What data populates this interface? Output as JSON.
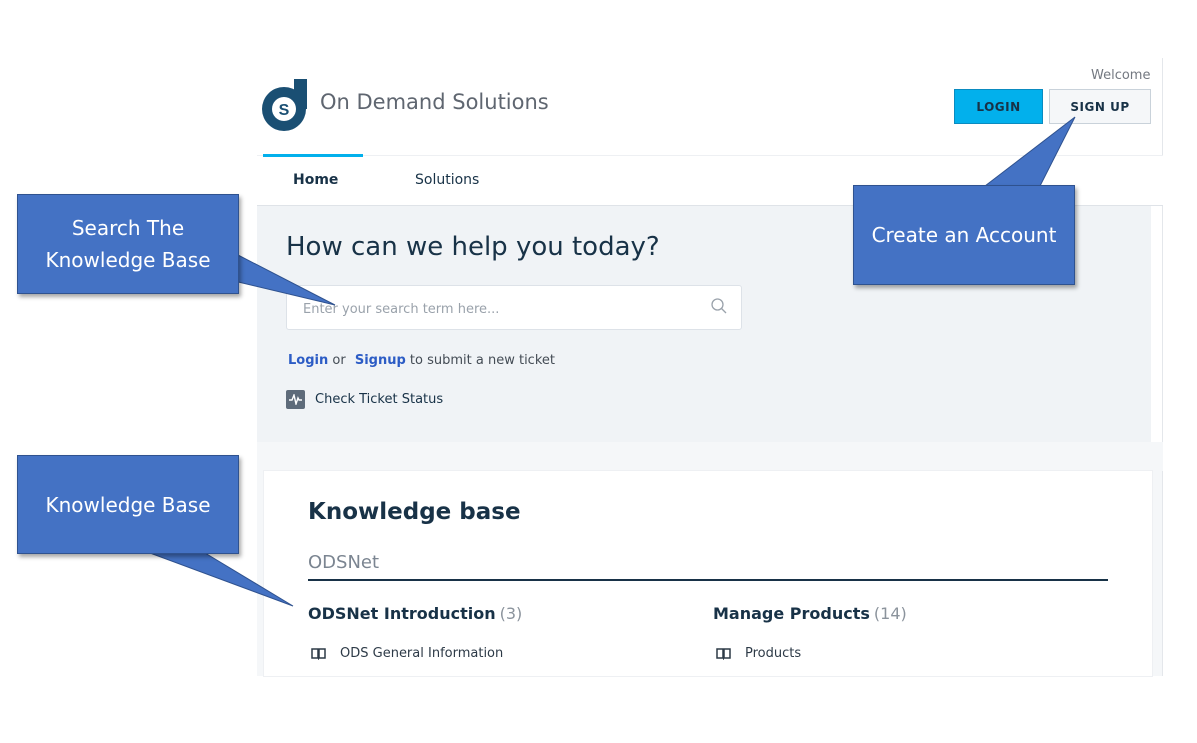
{
  "header": {
    "brand_name": "On Demand Solutions",
    "logo_letter": "S",
    "welcome_text": "Welcome",
    "login_label": "LOGIN",
    "signup_label": "SIGN UP"
  },
  "nav": {
    "tabs": [
      {
        "label": "Home",
        "active": true
      },
      {
        "label": "Solutions",
        "active": false
      }
    ]
  },
  "help": {
    "title": "How can we help you today?",
    "search_placeholder": "Enter your search term here...",
    "login_link": "Login",
    "or_text": "or",
    "signup_link": "Signup",
    "submit_text": "to submit a new ticket",
    "check_status": "Check Ticket Status"
  },
  "knowledge_base": {
    "title": "Knowledge base",
    "folder": "ODSNet",
    "categories": [
      {
        "name": "ODSNet Introduction",
        "count": "(3)",
        "first_article": "ODS General Information"
      },
      {
        "name": "Manage Products",
        "count": "(14)",
        "first_article": "Products"
      }
    ]
  },
  "callouts": {
    "search_line1": "Search The",
    "search_line2": "Knowledge Base",
    "account": "Create an Account",
    "kb": "Knowledge Base"
  },
  "colors": {
    "accent": "#02b0ec",
    "callout": "#4472c4",
    "navy": "#183247",
    "link": "#2c5cc5",
    "logo": "#1a4f73"
  }
}
